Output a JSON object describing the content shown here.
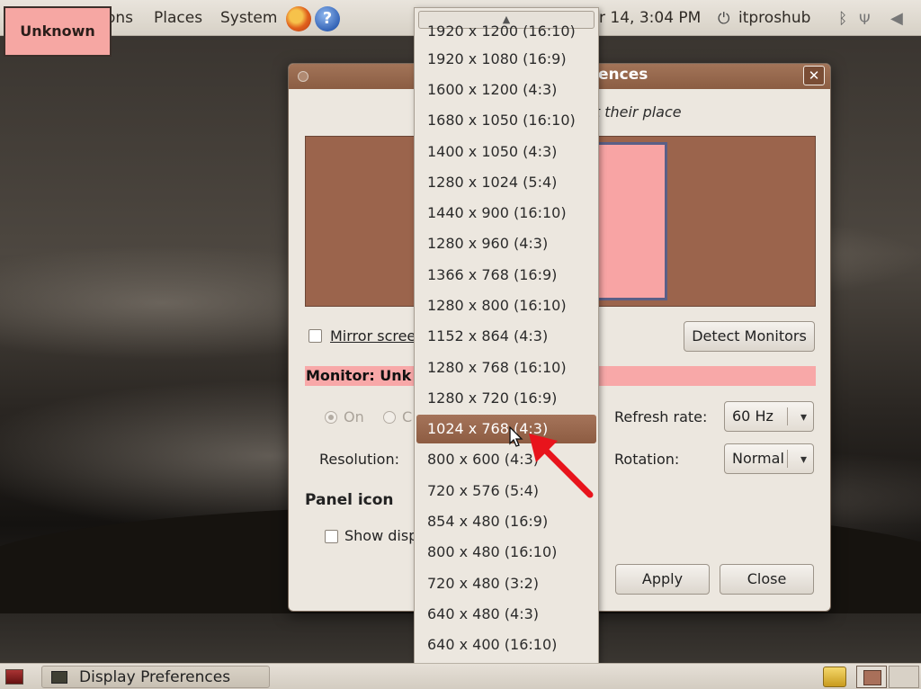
{
  "top_panel": {
    "menu_applications_partial": "ons",
    "menu_places": "Places",
    "menu_system": "System",
    "clock": "r 14,  3:04 PM",
    "user": "itproshub"
  },
  "tooltip_label": "Unknown",
  "dialog": {
    "title_partial": "ences",
    "instruction_partial": "et their place",
    "monitor_label_partial": "n",
    "mirror_label": "Mirror scree",
    "detect_button": "Detect Monitors",
    "monitor_heading": "Monitor: Unk",
    "on_label": "On",
    "off_label_partial": "C",
    "refresh_label": "Refresh rate:",
    "refresh_value": "60 Hz",
    "resolution_label": "Resolution:",
    "rotation_label": "Rotation:",
    "rotation_value": "Normal",
    "panel_icon_heading": "Panel icon",
    "show_display_label": "Show disp",
    "apply_button": "Apply",
    "close_button": "Close"
  },
  "resolution_list": {
    "top_partial": "1920 x 1200 (16:10)",
    "options": [
      "1920 x 1080 (16:9)",
      "1600 x 1200 (4:3)",
      "1680 x 1050 (16:10)",
      "1400 x 1050 (4:3)",
      "1280 x 1024 (5:4)",
      "1440 x 900 (16:10)",
      "1280 x 960 (4:3)",
      "1366 x 768 (16:9)",
      "1280 x 800 (16:10)",
      "1152 x 864 (4:3)",
      "1280 x 768 (16:10)",
      "1280 x 720 (16:9)",
      "1024 x 768 (4:3)",
      "800 x 600 (4:3)",
      "720 x 576 (5:4)",
      "854 x 480 (16:9)",
      "800 x 480 (16:10)",
      "720 x 480 (3:2)",
      "640 x 480 (4:3)",
      "640 x 400 (16:10)"
    ],
    "selected": "1024 x 768 (4:3)"
  },
  "bottom_panel": {
    "task_label": "Display Preferences"
  },
  "colors": {
    "title_bar": "#9a6a4f",
    "selection": "#9a6a4f",
    "monitor_fill": "#f8a4a4",
    "annotation_arrow": "#e8141c"
  }
}
